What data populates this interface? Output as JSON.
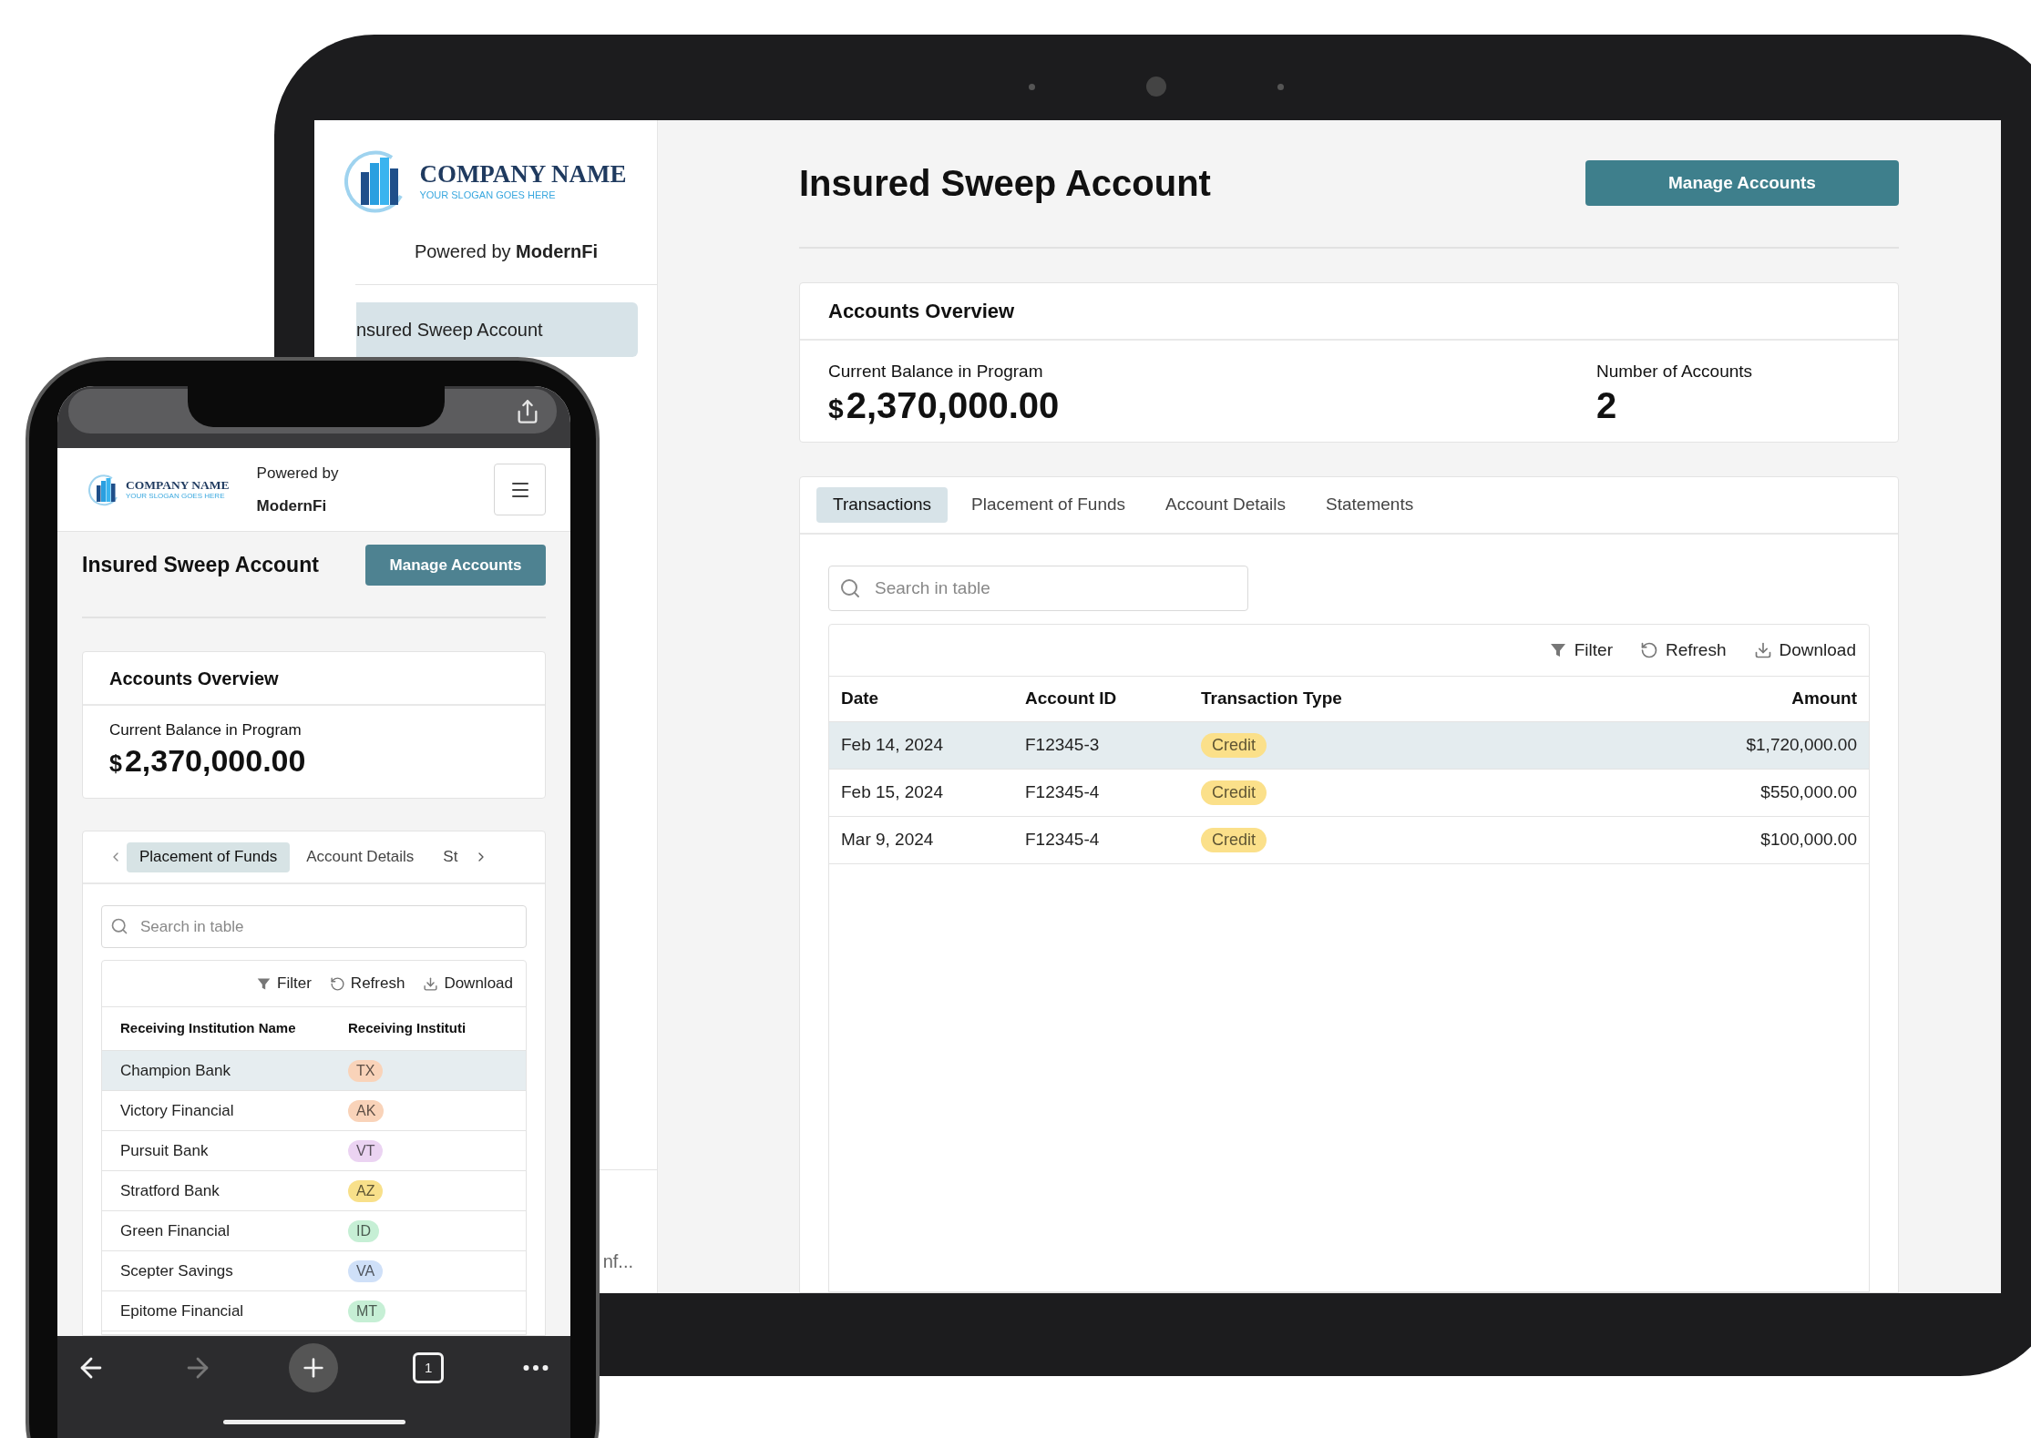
{
  "tablet": {
    "sidebar": {
      "logo": {
        "name": "COMPANY NAME",
        "slogan": "YOUR SLOGAN GOES HERE"
      },
      "powered_by": "Powered by **ModernFi**",
      "items": [
        {
          "label": "nsured Sweep Account",
          "selected": true
        }
      ],
      "footer": "nf..."
    },
    "page_title": "Insured Sweep Account",
    "manage_button": "Manage Accounts",
    "overview": {
      "title": "Accounts Overview",
      "balance_label": "Current Balance in Program",
      "balance_currency": "$",
      "balance_value": "2,370,000.00",
      "accounts_label": "Number of Accounts",
      "accounts_value": "2"
    },
    "tabs": [
      {
        "label": "Transactions",
        "selected": true
      },
      {
        "label": "Placement of Funds",
        "selected": false
      },
      {
        "label": "Account Details",
        "selected": false
      },
      {
        "label": "Statements",
        "selected": false
      }
    ],
    "search": {
      "placeholder": "Search in table"
    },
    "toolbar": [
      {
        "kind": "filter",
        "label": "Filter"
      },
      {
        "kind": "refresh",
        "label": "Refresh"
      },
      {
        "kind": "download",
        "label": "Download"
      }
    ],
    "table": {
      "columns": [
        "Date",
        "Account ID",
        "Transaction Type",
        "Amount"
      ],
      "rows": [
        {
          "selected": true,
          "date": "Feb 14, 2024",
          "account_id": "F12345-3",
          "type": {
            "label": "Credit",
            "color": "#fbe08a"
          },
          "amount": "$1,720,000.00"
        },
        {
          "selected": false,
          "date": "Feb 15, 2024",
          "account_id": "F12345-4",
          "type": {
            "label": "Credit",
            "color": "#fbe08a"
          },
          "amount": "$550,000.00"
        },
        {
          "selected": false,
          "date": "Mar 9, 2024",
          "account_id": "F12345-4",
          "type": {
            "label": "Credit",
            "color": "#fbe08a"
          },
          "amount": "$100,000.00"
        }
      ]
    }
  },
  "phone": {
    "header": {
      "logo": {
        "name": "COMPANY NAME",
        "slogan": "YOUR SLOGAN GOES HERE"
      },
      "powered_by": "Powered by **ModernFi**"
    },
    "page_title": "Insured Sweep Account",
    "manage_button": "Manage Accounts",
    "overview": {
      "title": "Accounts Overview",
      "balance_label": "Current Balance in Program",
      "balance_currency": "$",
      "balance_value": "2,370,000.00"
    },
    "tabs": [
      {
        "label": "Placement of Funds",
        "selected": true
      },
      {
        "label": "Account Details",
        "selected": false
      },
      {
        "label": "St",
        "selected": false
      }
    ],
    "search": {
      "placeholder": "Search in table"
    },
    "toolbar": [
      {
        "kind": "filter",
        "label": "Filter"
      },
      {
        "kind": "refresh",
        "label": "Refresh"
      },
      {
        "kind": "download",
        "label": "Download"
      }
    ],
    "table": {
      "columns": [
        "Receiving Institution Name",
        "Receiving Instituti"
      ],
      "rows": [
        {
          "selected": true,
          "name": "Champion Bank",
          "state": {
            "label": "TX",
            "color": "#f9d3b9"
          }
        },
        {
          "selected": false,
          "name": "Victory Financial",
          "state": {
            "label": "AK",
            "color": "#f9d3b9"
          }
        },
        {
          "selected": false,
          "name": "Pursuit Bank",
          "state": {
            "label": "VT",
            "color": "#ebd3f2"
          }
        },
        {
          "selected": false,
          "name": "Stratford Bank",
          "state": {
            "label": "AZ",
            "color": "#f8e08a"
          }
        },
        {
          "selected": false,
          "name": "Green Financial",
          "state": {
            "label": "ID",
            "color": "#c6efd5"
          }
        },
        {
          "selected": false,
          "name": "Scepter Savings",
          "state": {
            "label": "VA",
            "color": "#cfe0f8"
          }
        },
        {
          "selected": false,
          "name": "Epitome Financial",
          "state": {
            "label": "MT",
            "color": "#c6efd5"
          }
        }
      ]
    },
    "browser_bar": {
      "tab_count": "1",
      "forward_disabled": true
    }
  }
}
